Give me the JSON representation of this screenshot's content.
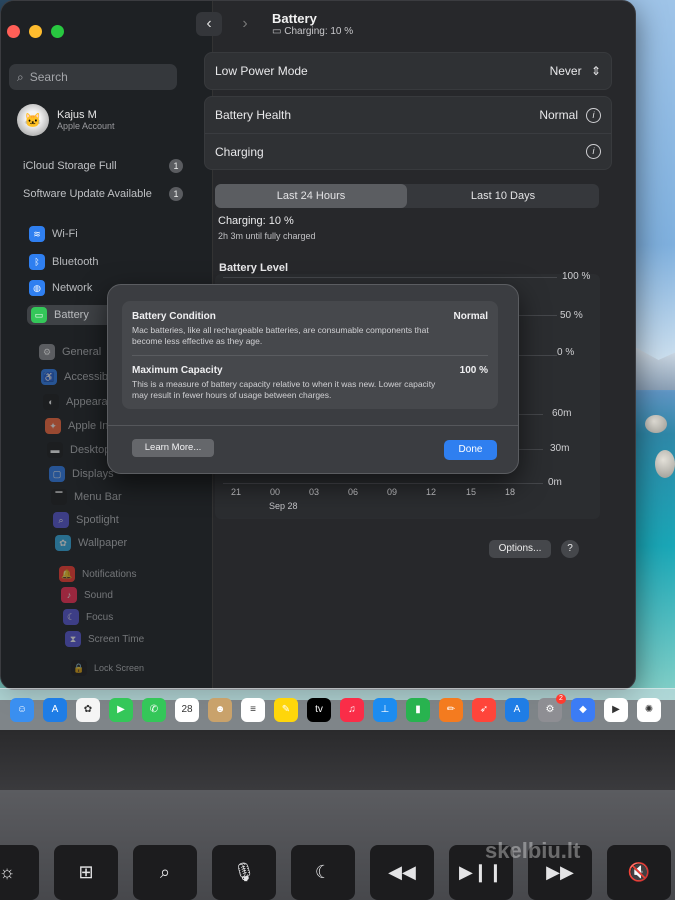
{
  "window": {
    "title": "Battery",
    "subtitle": "Charging: 10 %"
  },
  "sidebar": {
    "search_placeholder": "Search",
    "account": {
      "name": "Kajus M",
      "subtitle": "Apple Account"
    },
    "notices": [
      {
        "label": "iCloud Storage Full",
        "count": "1"
      },
      {
        "label": "Software Update Available",
        "count": "1"
      }
    ],
    "items": [
      {
        "label": "Wi-Fi",
        "icon": "wifi-icon",
        "color": "#2f7ff0"
      },
      {
        "label": "Bluetooth",
        "icon": "bluetooth-icon",
        "color": "#2f7ff0"
      },
      {
        "label": "Network",
        "icon": "globe-icon",
        "color": "#2f7ff0"
      },
      {
        "label": "Battery",
        "icon": "battery-icon",
        "color": "#34c759"
      },
      {
        "label": "General",
        "icon": "gear-icon",
        "color": "#8e8e93"
      },
      {
        "label": "Accessibility",
        "icon": "accessibility-icon",
        "color": "#2f7ff0"
      },
      {
        "label": "Appearance",
        "icon": "appearance-icon",
        "color": "#1c1c1e"
      },
      {
        "label": "Apple Intelligence",
        "icon": "intelligence-icon",
        "color": "#ff6a3d"
      },
      {
        "label": "Desktop & Dock",
        "icon": "dock-icon",
        "color": "#1c1c1e"
      },
      {
        "label": "Displays",
        "icon": "display-icon",
        "color": "#2f7ff0"
      },
      {
        "label": "Menu Bar",
        "icon": "menubar-icon",
        "color": "#1c1c1e"
      },
      {
        "label": "Spotlight",
        "icon": "spotlight-icon",
        "color": "#5856d6"
      },
      {
        "label": "Wallpaper",
        "icon": "wallpaper-icon",
        "color": "#32ade6"
      },
      {
        "label": "Notifications",
        "icon": "bell-icon",
        "color": "#ff3b30"
      },
      {
        "label": "Sound",
        "icon": "sound-icon",
        "color": "#ff2d55"
      },
      {
        "label": "Focus",
        "icon": "moon-icon",
        "color": "#5856d6"
      },
      {
        "label": "Screen Time",
        "icon": "hourglass-icon",
        "color": "#5856d6"
      },
      {
        "label": "Lock Screen",
        "icon": "lock-icon",
        "color": "#1c1c1e"
      }
    ]
  },
  "settings": {
    "low_power": {
      "label": "Low Power Mode",
      "value": "Never"
    },
    "battery_health": {
      "label": "Battery Health",
      "value": "Normal"
    },
    "charging": {
      "label": "Charging"
    }
  },
  "tabs": [
    {
      "label": "Last 24 Hours",
      "active": true
    },
    {
      "label": "Last 10 Days",
      "active": false
    }
  ],
  "charging_status": {
    "label": "Charging: 10 %",
    "detail": "2h 3m until fully charged"
  },
  "chart_data": {
    "type": "bar",
    "title": "Battery Level",
    "y_level_ticks": [
      "100 %",
      "50 %",
      "0 %"
    ],
    "y_usage_ticks": [
      "60m",
      "30m",
      "0m"
    ],
    "x_ticks": [
      "21",
      "00",
      "03",
      "06",
      "09",
      "12",
      "15",
      "18"
    ],
    "x_date": "Sep 28"
  },
  "buttons": {
    "options": "Options...",
    "help": "?"
  },
  "modal": {
    "condition": {
      "title": "Battery Condition",
      "value": "Normal",
      "description": "Mac batteries, like all rechargeable batteries, are consumable components that become less effective as they age."
    },
    "capacity": {
      "title": "Maximum Capacity",
      "value": "100 %",
      "description": "This is a measure of battery capacity relative to when it was new. Lower capacity may result in fewer hours of usage between charges."
    },
    "learn_more": "Learn More...",
    "done": "Done"
  },
  "dock": [
    {
      "name": "finder-app-icon",
      "color": "#3a8ff0",
      "glyph": "☺"
    },
    {
      "name": "appstore-dock-app-icon",
      "color": "#1f7de6",
      "glyph": "A"
    },
    {
      "name": "photos-app-icon",
      "color": "#f5f5f5",
      "glyph": "✿"
    },
    {
      "name": "facetime-app-icon",
      "color": "#34c759",
      "glyph": "▶"
    },
    {
      "name": "phone-app-icon",
      "color": "#34c759",
      "glyph": "✆"
    },
    {
      "name": "calendar-app-icon",
      "color": "#ffffff",
      "glyph": "28"
    },
    {
      "name": "contacts-app-icon",
      "color": "#c9a26b",
      "glyph": "☻"
    },
    {
      "name": "reminders-app-icon",
      "color": "#ffffff",
      "glyph": "≡"
    },
    {
      "name": "notes-app-icon",
      "color": "#ffd60a",
      "glyph": "✎"
    },
    {
      "name": "tv-app-icon",
      "color": "#000000",
      "glyph": "tv"
    },
    {
      "name": "music-app-icon",
      "color": "#fa2d48",
      "glyph": "♫"
    },
    {
      "name": "keynote-app-icon",
      "color": "#1c8cf0",
      "glyph": "⊥"
    },
    {
      "name": "numbers-app-icon",
      "color": "#28b34f",
      "glyph": "▮"
    },
    {
      "name": "pages-app-icon",
      "color": "#f47b1f",
      "glyph": "✏"
    },
    {
      "name": "rocket-app-icon",
      "color": "#ff453a",
      "glyph": "➶"
    },
    {
      "name": "appstore-app-icon",
      "color": "#1f7de6",
      "glyph": "A"
    },
    {
      "name": "settings-app-icon",
      "color": "#8e8e93",
      "glyph": "⚙",
      "badge": "2"
    },
    {
      "name": "roblox-app-icon",
      "color": "#3c7cf5",
      "glyph": "◆"
    },
    {
      "name": "youtube-app-icon",
      "color": "#ffffff",
      "glyph": "▶"
    },
    {
      "name": "chatgpt-app-icon",
      "color": "#ffffff",
      "glyph": "✺"
    }
  ],
  "keys": [
    {
      "name": "brightness-key",
      "glyph": "☼"
    },
    {
      "name": "mission-control-key",
      "glyph": "⊞"
    },
    {
      "name": "spotlight-key",
      "glyph": "⌕"
    },
    {
      "name": "dictation-key",
      "glyph": "🎙"
    },
    {
      "name": "focus-key",
      "glyph": "☾"
    },
    {
      "name": "rewind-key",
      "glyph": "◀◀"
    },
    {
      "name": "play-pause-key",
      "glyph": "▶❙❙"
    },
    {
      "name": "fast-forward-key",
      "glyph": "▶▶"
    },
    {
      "name": "mute-key",
      "glyph": "🔇"
    }
  ],
  "watermark": "skelbiu.lt"
}
